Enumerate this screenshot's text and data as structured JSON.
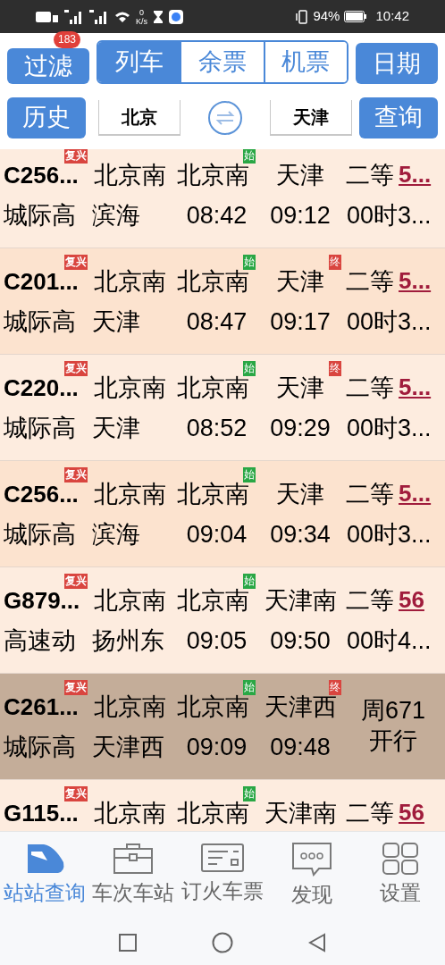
{
  "status_bar": {
    "speed": "0",
    "speed_unit": "K/s",
    "battery": "94%",
    "time": "10:42"
  },
  "toolbar": {
    "filter_button": "过滤",
    "filter_badge": "183",
    "segments": [
      {
        "label": "列车",
        "selected": true
      },
      {
        "label": "余票",
        "selected": false
      },
      {
        "label": "机票",
        "selected": false
      }
    ],
    "date_button": "日期"
  },
  "search": {
    "history_button": "历史",
    "from": "北京",
    "to": "天津",
    "query_button": "查询"
  },
  "trains": [
    {
      "kind": "seat",
      "selected": false,
      "number": "C256...",
      "badge": "复兴",
      "from": "北京南",
      "origin": "北京南",
      "origin_badge": "始",
      "to": "天津",
      "seat": "二等",
      "price": "5...",
      "type": "城际高",
      "terminal": "滨海",
      "depart": "08:42",
      "arrive": "09:12",
      "duration": "00时3..."
    },
    {
      "kind": "seat",
      "selected": false,
      "number": "C201...",
      "badge": "复兴",
      "from": "北京南",
      "origin": "北京南",
      "origin_badge": "始",
      "to": "天津",
      "to_badge": "终",
      "seat": "二等",
      "price": "5...",
      "type": "城际高",
      "terminal": "天津",
      "depart": "08:47",
      "arrive": "09:17",
      "duration": "00时3..."
    },
    {
      "kind": "seat",
      "selected": false,
      "number": "C220...",
      "badge": "复兴",
      "from": "北京南",
      "origin": "北京南",
      "origin_badge": "始",
      "to": "天津",
      "to_badge": "终",
      "seat": "二等",
      "price": "5...",
      "type": "城际高",
      "terminal": "天津",
      "depart": "08:52",
      "arrive": "09:29",
      "duration": "00时3..."
    },
    {
      "kind": "seat",
      "selected": false,
      "number": "C256...",
      "badge": "复兴",
      "from": "北京南",
      "origin": "北京南",
      "origin_badge": "始",
      "to": "天津",
      "seat": "二等",
      "price": "5...",
      "type": "城际高",
      "terminal": "滨海",
      "depart": "09:04",
      "arrive": "09:34",
      "duration": "00时3..."
    },
    {
      "kind": "seat",
      "selected": false,
      "number": "G879...",
      "badge": "复兴",
      "from": "北京南",
      "origin": "北京南",
      "origin_badge": "始",
      "to": "天津南",
      "seat": "二等",
      "price": "56",
      "type": "高速动",
      "terminal": "扬州东",
      "depart": "09:05",
      "arrive": "09:50",
      "duration": "00时4..."
    },
    {
      "kind": "notice",
      "selected": true,
      "number": "C261...",
      "badge": "复兴",
      "from": "北京南",
      "origin": "北京南",
      "origin_badge": "始",
      "to": "天津西",
      "to_badge": "终",
      "notice": [
        "周671",
        "开行"
      ],
      "type": "城际高",
      "terminal": "天津西",
      "depart": "09:09",
      "arrive": "09:48"
    },
    {
      "kind": "seat",
      "selected": false,
      "number": "G115...",
      "badge": "复兴",
      "from": "北京南",
      "origin": "北京南",
      "origin_badge": "始",
      "to": "天津南",
      "seat": "二等",
      "price": "56"
    }
  ],
  "tab_bar": [
    {
      "label": "站站查询",
      "selected": true
    },
    {
      "label": "车次车站",
      "selected": false
    },
    {
      "label": "订火车票",
      "selected": false
    },
    {
      "label": "发现",
      "selected": false
    },
    {
      "label": "设置",
      "selected": false
    }
  ]
}
